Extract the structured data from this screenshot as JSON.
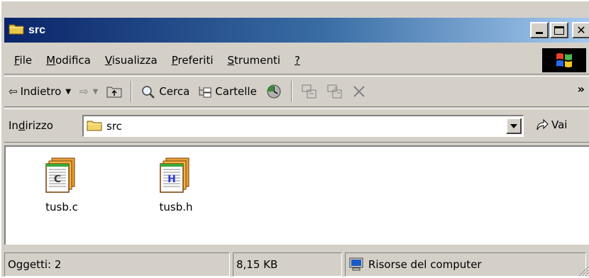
{
  "window": {
    "title": "src"
  },
  "menu": {
    "items": [
      {
        "accel": "F",
        "rest": "ile"
      },
      {
        "accel": "M",
        "rest": "odifica"
      },
      {
        "accel": "V",
        "rest": "isualizza"
      },
      {
        "accel": "P",
        "rest": "referiti"
      },
      {
        "accel": "S",
        "rest": "trumenti"
      },
      {
        "accel": "?",
        "rest": ""
      }
    ]
  },
  "toolbar": {
    "back_label": "Indietro",
    "search_label": "Cerca",
    "folders_label": "Cartelle",
    "more_label": "»"
  },
  "address": {
    "label_pre": "In",
    "label_accel": "d",
    "label_post": "irizzo",
    "value": "src",
    "go_label": "Vai"
  },
  "files": [
    {
      "name": "tusb.c",
      "icon": "c-source-file-icon",
      "letter": "C"
    },
    {
      "name": "tusb.h",
      "icon": "h-header-file-icon",
      "letter": "H"
    }
  ],
  "status": {
    "objects": "Oggetti: 2",
    "size": "8,15 KB",
    "zone": "Risorse del computer"
  },
  "colors": {
    "title_start": "#0a246a",
    "title_end": "#a6caf0",
    "face": "#d4d0c8"
  }
}
